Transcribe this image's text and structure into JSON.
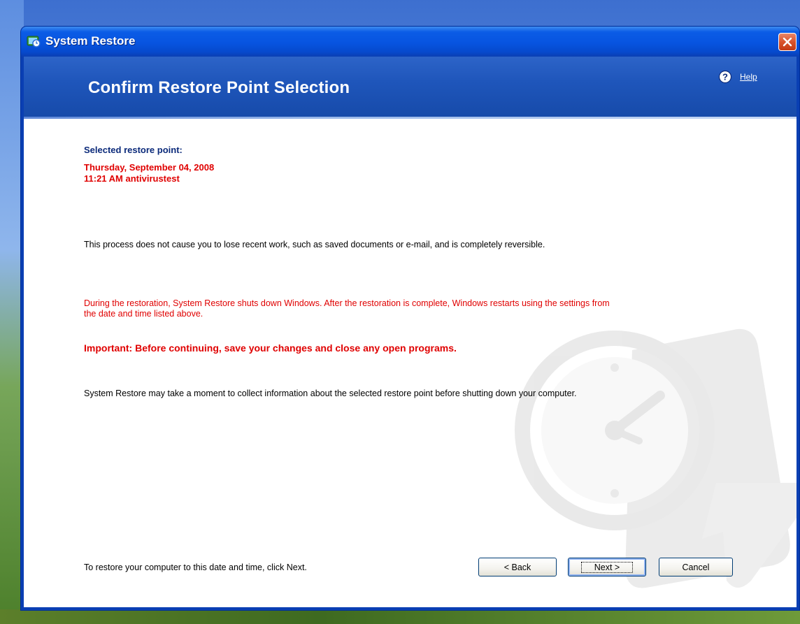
{
  "window": {
    "title": "System Restore",
    "close_label": "Close"
  },
  "header": {
    "page_title": "Confirm Restore Point Selection",
    "help_label": "Help"
  },
  "selection": {
    "label": "Selected restore point:",
    "date": "Thursday, September 04, 2008",
    "name": "11:21 AM antivirustest"
  },
  "body": {
    "paragraph1": "This process does not cause you to lose recent work, such as saved documents or e-mail, and is completely reversible.",
    "paragraph2": "During the restoration, System Restore shuts down Windows. After the restoration is complete, Windows restarts using the settings from the date and time listed above.",
    "important": "Important: Before continuing, save your changes and close any open programs.",
    "paragraph3": "System Restore may take a moment to collect information about the selected restore point before shutting down your computer."
  },
  "footer": {
    "instruction": "To restore your computer to this date and time, click Next.",
    "back_label": "< Back",
    "next_label": "Next >",
    "cancel_label": "Cancel"
  },
  "colors": {
    "title_blue": "#0754e0",
    "header_blue": "#1f56bb",
    "label_navy": "#0b2a7a",
    "warning_red": "#e00000",
    "close_red": "#d9532b"
  },
  "icons": {
    "app": "system-restore-icon",
    "help": "help-question-icon",
    "close": "close-x-icon",
    "watermark": "clock-restore-watermark"
  }
}
